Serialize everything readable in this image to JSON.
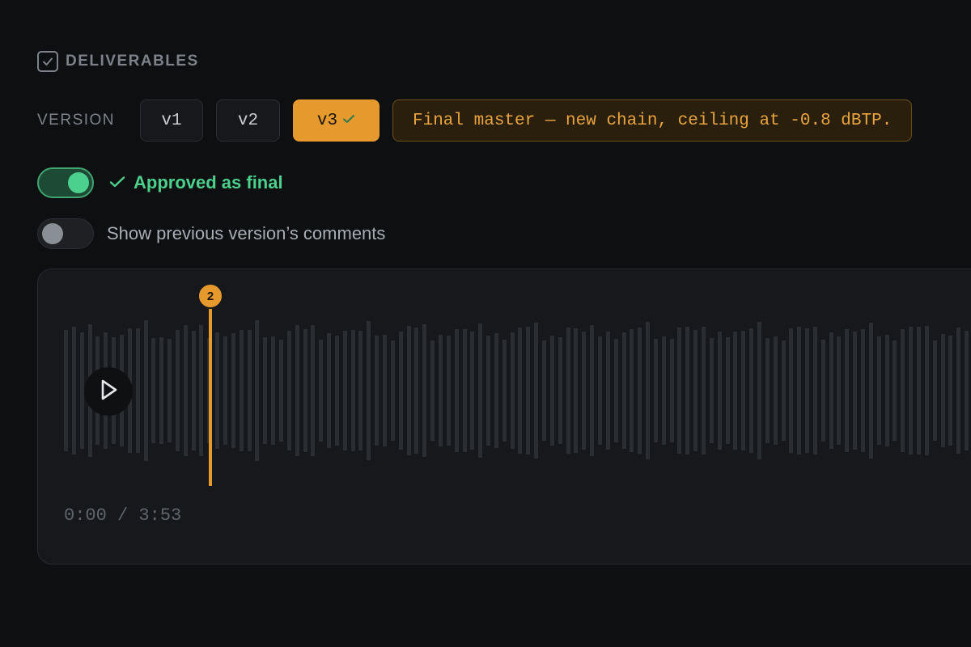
{
  "section": {
    "title": "DELIVERABLES",
    "icon": "checkbox-icon"
  },
  "versions": {
    "label": "VERSION",
    "items": [
      {
        "label": "v1",
        "active": false
      },
      {
        "label": "v2",
        "active": false
      },
      {
        "label": "v3",
        "active": true,
        "approved": true
      }
    ],
    "note": "Final master — new chain, ceiling at -0.8 dBTP."
  },
  "approval": {
    "on": true,
    "label": "Approved as final",
    "icon": "check-icon"
  },
  "show_previous_comments": {
    "on": false,
    "label": "Show previous version’s comments"
  },
  "player": {
    "time": "0:00 / 3:53",
    "markers": [
      {
        "label": "2"
      }
    ],
    "play_icon": "play-icon"
  },
  "colors": {
    "accent": "#e69a2e",
    "approved": "#4bd08d",
    "background": "#0e0f11",
    "panel": "#16181b"
  }
}
